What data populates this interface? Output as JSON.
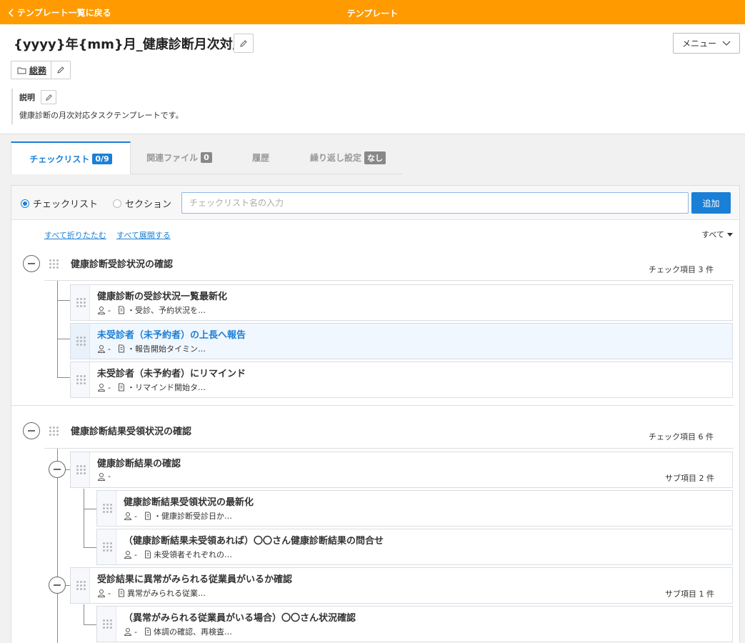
{
  "topbar": {
    "back_label": "テンプレート一覧に戻る",
    "title": "テンプレート",
    "color": "#ff9b00"
  },
  "header": {
    "title": "{yyyy}年{mm}月_健康診断月次対応",
    "menu_label": "メニュー",
    "folder": "総務"
  },
  "description": {
    "label": "説明",
    "text": "健康診断の月次対応タスクテンプレートです。"
  },
  "tabs": [
    {
      "label": "チェックリスト",
      "badge": "0/9",
      "active": true
    },
    {
      "label": "関連ファイル",
      "badge": "0",
      "active": false
    },
    {
      "label": "履歴",
      "badge": "",
      "active": false
    },
    {
      "label": "繰り返し設定",
      "badge": "なし",
      "active": false
    }
  ],
  "add_form": {
    "radio_checklist": "チェックリスト",
    "radio_section": "セクション",
    "selected": "checklist",
    "placeholder": "チェックリスト名の入力",
    "add_label": "追加"
  },
  "controls": {
    "collapse_all": "すべて折りたたむ",
    "expand_all": "すべて展開する",
    "filter": "すべて"
  },
  "sections": [
    {
      "title": "健康診断受診状況の確認",
      "count": "チェック項目 3 件",
      "items": [
        {
          "title": "健康診断の受診状況一覧最新化",
          "assignee": "-",
          "note": "・受診、予約状況を…"
        },
        {
          "title": "未受診者（未予約者）の上長へ報告",
          "assignee": "-",
          "note": "・報告開始タイミン…"
        },
        {
          "title": "未受診者（未予約者）にリマインド",
          "assignee": "-",
          "note": "・リマインド開始タ…"
        }
      ]
    },
    {
      "title": "健康診断結果受領状況の確認",
      "count": "チェック項目 6 件",
      "items": [
        {
          "title": "健康診断結果の確認",
          "assignee": "-",
          "sub_count": "サブ項目 2 件",
          "children": [
            {
              "title": "健康診断結果受領状況の最新化",
              "assignee": "-",
              "note": "・健康診断受診日か…"
            },
            {
              "title": "（健康診断結果未受領あれば）〇〇さん健康診断結果の問合せ",
              "assignee": "-",
              "note": "未受領者それぞれの…"
            }
          ]
        },
        {
          "title": "受診結果に異常がみられる従業員がいるか確認",
          "assignee": "-",
          "note": "異常がみられる従業…",
          "sub_count": "サブ項目 1 件",
          "children": [
            {
              "title": "（異常がみられる従業員がいる場合）〇〇さん状況確認",
              "assignee": "-",
              "note": "体調の確認、再検査…"
            }
          ]
        }
      ]
    }
  ],
  "colors": {
    "accent": "#1a7fd6",
    "highlight_row": "#f1f7fe"
  }
}
